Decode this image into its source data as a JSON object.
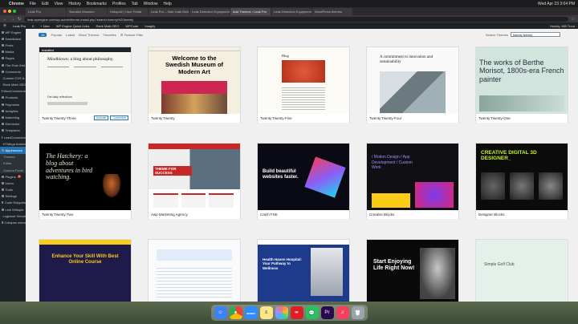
{
  "menubar": {
    "app": "Chrome",
    "items": [
      "File",
      "Edit",
      "View",
      "History",
      "Bookmarks",
      "Profiles",
      "Tab",
      "Window",
      "Help"
    ],
    "clock": "Wed Apr 23 3:04 PM"
  },
  "tabs": [
    "Leak Pro",
    "Swedish Museum",
    "Hotspot2 | User Portal",
    "Leak Pro – Slab Leak Detection",
    "Leak Detection Equipment",
    "Add Themes ‹ Leak Pro",
    "Leak Detection Equipment",
    "WordPress themes"
  ],
  "address": {
    "url": "leak.wpengine.com/wp-admin/theme-install.php?search=twenty%20twenty"
  },
  "adminbar": {
    "items": [
      "Leak Pro",
      "0",
      "+ New",
      "WP Engine Quick Links",
      "Rank Math SEO",
      "WPCode",
      "Imagify"
    ],
    "greeting": "Howdy, Will Trout"
  },
  "sidebar": {
    "items": [
      {
        "label": "WP Engine",
        "state": ""
      },
      {
        "label": "Dashboard",
        "state": ""
      },
      {
        "label": "Posts",
        "state": ""
      },
      {
        "label": "Media",
        "state": ""
      },
      {
        "label": "Pages",
        "state": ""
      },
      {
        "label": "The Post Grid",
        "state": ""
      },
      {
        "label": "Comments",
        "state": ""
      },
      {
        "label": "Custom CSS & JS",
        "state": ""
      },
      {
        "label": "Rank Math SEO",
        "state": ""
      },
      {
        "label": "WooCommerce",
        "state": ""
      },
      {
        "label": "Products",
        "state": ""
      },
      {
        "label": "Payments",
        "state": ""
      },
      {
        "label": "Analytics",
        "state": ""
      },
      {
        "label": "Marketing",
        "state": ""
      },
      {
        "label": "Elementor",
        "state": ""
      },
      {
        "label": "Templates",
        "state": ""
      },
      {
        "label": "LeadConnector",
        "state": ""
      },
      {
        "label": "HTMega Addons",
        "state": ""
      },
      {
        "label": "Appearance",
        "state": "active"
      },
      {
        "label": "Themes",
        "state": "sub"
      },
      {
        "label": "Editor",
        "state": "sub"
      },
      {
        "label": "Custom Fonts",
        "state": "sub"
      },
      {
        "label": "Plugins",
        "state": "",
        "badge": "6"
      },
      {
        "label": "Users",
        "state": ""
      },
      {
        "label": "Tools",
        "state": ""
      },
      {
        "label": "Settings",
        "state": ""
      },
      {
        "label": "Code Snippets",
        "state": ""
      },
      {
        "label": "Link Whisper",
        "state": ""
      },
      {
        "label": "Loginizer Security",
        "state": ""
      },
      {
        "label": "Collapse menu",
        "state": ""
      }
    ]
  },
  "filters": {
    "count": "16",
    "tabs": [
      "Popular",
      "Latest",
      "Block Themes",
      "Favorites"
    ],
    "feature_filter": "Feature Filter",
    "search_label": "Search Themes",
    "search_value": "twenty twenty"
  },
  "themes": [
    {
      "name": "Twenty Twenty-Three",
      "installed": "Installed",
      "activate": "Activate",
      "customize": "Customize"
    },
    {
      "name": "Twenty Twenty"
    },
    {
      "name": "Twenty Twenty-Five"
    },
    {
      "name": "Twenty Twenty-Four"
    },
    {
      "name": "Twenty Twenty-One"
    },
    {
      "name": "Twenty Twenty-Two"
    },
    {
      "name": "Awp Marketing Agency"
    },
    {
      "name": "Catch FSE"
    },
    {
      "name": "Creative Blocks"
    },
    {
      "name": "Designer Blocks"
    },
    {
      "name": ""
    },
    {
      "name": ""
    },
    {
      "name": ""
    },
    {
      "name": ""
    },
    {
      "name": ""
    }
  ],
  "thumbs": {
    "t1": {
      "heading": "Mindblown: a blog about philosophy.",
      "links": "Get daily reflections"
    },
    "t2": {
      "heading": "Welcome to the Swedish Museum of Modern Art"
    },
    "t3": {
      "heading": "Blog"
    },
    "t4": {
      "heading": "A commitment to innovation and sustainability"
    },
    "t5": {
      "heading": "The works of Berthe Morisot, 1800s-era French painter"
    },
    "t6": {
      "heading": "The Hatchery: a blog about adventures in bird watching."
    },
    "t7": {
      "heading": "THEME FOR SUCCESS"
    },
    "t8": {
      "heading": "Build beautiful websites faster."
    },
    "t9": {
      "heading": "/ Motion Design / App Development / Custom Work"
    },
    "t10": {
      "heading": "CREATIVE DIGITAL 3D DESIGNER_"
    },
    "t11": {
      "heading": "Enhance Your Skill With Best Online Course"
    },
    "t13": {
      "heading": "Health Haven Hospital: Your Pathway to Wellness"
    },
    "t14": {
      "heading": "Start Enjoying Life Right Now!"
    },
    "t15": {
      "heading": "Simple Golf Club"
    }
  },
  "dock": [
    "Finder",
    "Chrome",
    "Zoom",
    "Notes",
    "Photos",
    "Creative Cloud",
    "Messages",
    "Premiere",
    "Music",
    "Trash"
  ]
}
